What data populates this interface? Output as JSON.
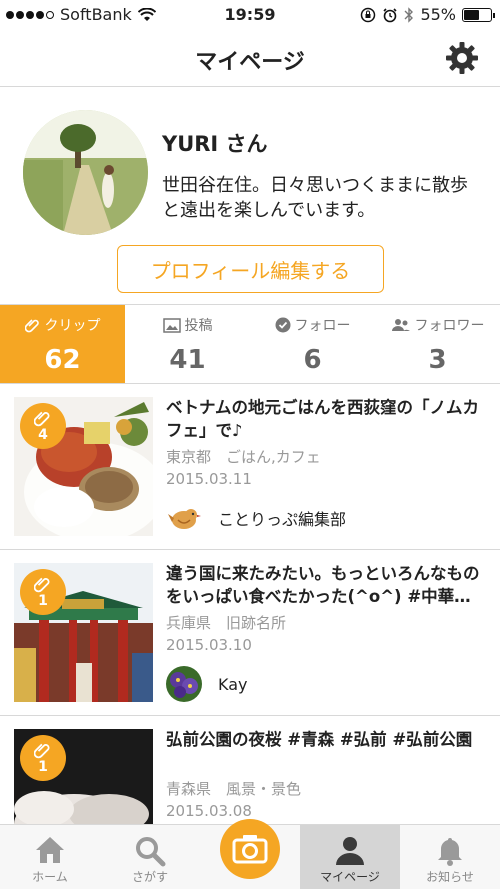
{
  "status_bar": {
    "carrier": "SoftBank",
    "time": "19:59",
    "battery": "55%",
    "battery_level": 0.55
  },
  "header": {
    "title": "マイページ",
    "settings_icon": "gear-icon"
  },
  "profile": {
    "name": "YURI さん",
    "bio": "世田谷在住。日々思いつくままに散歩と遠出を楽しんでいます。",
    "edit_button": "プロフィール編集する"
  },
  "stats": [
    {
      "label": "クリップ",
      "value": "62",
      "icon": "paperclip-icon",
      "active": true
    },
    {
      "label": "投稿",
      "value": "41",
      "icon": "image-icon",
      "active": false
    },
    {
      "label": "フォロー",
      "value": "6",
      "icon": "check-circle-icon",
      "active": false
    },
    {
      "label": "フォロワー",
      "value": "3",
      "icon": "people-icon",
      "active": false
    }
  ],
  "posts": [
    {
      "clips": "4",
      "title": "ベトナムの地元ごはんを西荻窪の「ノムカフェ」で♪",
      "meta": "東京都　ごはん,カフェ",
      "date": "2015.03.11",
      "author": "ことりっぷ編集部"
    },
    {
      "clips": "1",
      "title": "違う国に来たみたい。もっといろんなものをいっぱい食べたかった(^o^) #中華…",
      "meta": "兵庫県　旧跡名所",
      "date": "2015.03.10",
      "author": "Kay"
    },
    {
      "clips": "1",
      "title": "弘前公園の夜桜 #青森 #弘前 #弘前公園",
      "meta": "青森県　風景・景色",
      "date": "2015.03.08",
      "author": ""
    }
  ],
  "tabbar": [
    {
      "label": "ホーム",
      "icon": "home-icon"
    },
    {
      "label": "さがす",
      "icon": "search-icon"
    },
    {
      "label": "",
      "icon": "camera-icon"
    },
    {
      "label": "マイページ",
      "icon": "person-icon"
    },
    {
      "label": "お知らせ",
      "icon": "bell-icon"
    }
  ],
  "colors": {
    "accent": "#f5a623",
    "divider": "#d8d8d8",
    "muted": "#999999"
  }
}
